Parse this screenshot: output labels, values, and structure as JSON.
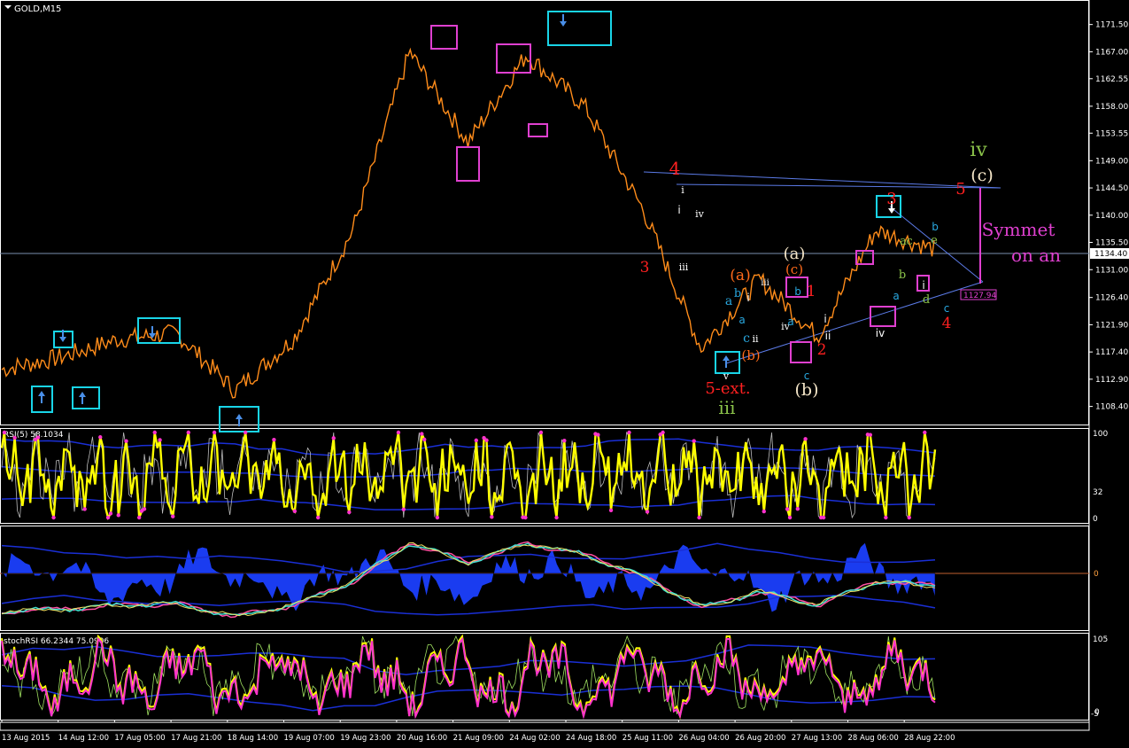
{
  "window": {
    "symbol_title": "GOLD,M15"
  },
  "price_axis": {
    "ticks": [
      "1171.50",
      "1167.00",
      "1162.55",
      "1158.00",
      "1153.55",
      "1149.00",
      "1144.50",
      "1140.00",
      "1135.50",
      "1131.00",
      "1126.40",
      "1121.90",
      "1117.40",
      "1112.90",
      "1108.40"
    ],
    "current_price": "1134.40",
    "target_box": "1127.94"
  },
  "time_axis": {
    "ticks": [
      "13 Aug 2015",
      "14 Aug 12:00",
      "17 Aug 05:00",
      "17 Aug 21:00",
      "18 Aug 14:00",
      "19 Aug 07:00",
      "19 Aug 23:00",
      "20 Aug 16:00",
      "21 Aug 09:00",
      "24 Aug 02:00",
      "24 Aug 18:00",
      "25 Aug 11:00",
      "26 Aug 04:00",
      "26 Aug 20:00",
      "27 Aug 13:00",
      "28 Aug 06:00",
      "28 Aug 22:00"
    ]
  },
  "wave_labels": [
    {
      "text": "4",
      "color": "#ff2020"
    },
    {
      "text": "3",
      "color": "#ff2020"
    },
    {
      "text": "i",
      "color": "#ffffff"
    },
    {
      "text": "ii",
      "color": "#ffffff"
    },
    {
      "text": "iii",
      "color": "#ffffff"
    },
    {
      "text": "iv",
      "color": "#ffffff"
    },
    {
      "text": "(a)",
      "color": "#ff6a1a"
    },
    {
      "text": "(b)",
      "color": "#ff6a1a"
    },
    {
      "text": "(c)",
      "color": "#ff6a1a"
    },
    {
      "text": "(a)",
      "color": "#f5e6c8"
    },
    {
      "text": "(b)",
      "color": "#f5e6c8"
    },
    {
      "text": "(c)",
      "color": "#f5e6c8"
    },
    {
      "text": "5-ext.",
      "color": "#ff2020"
    },
    {
      "text": "iii",
      "color": "#8bc34a"
    },
    {
      "text": "iv",
      "color": "#8bc34a"
    },
    {
      "text": "v",
      "color": "#ffffff"
    },
    {
      "text": "a",
      "color": "#29a8e0"
    },
    {
      "text": "b",
      "color": "#29a8e0"
    },
    {
      "text": "c",
      "color": "#29a8e0"
    },
    {
      "text": "1",
      "color": "#ff2020"
    },
    {
      "text": "2",
      "color": "#ff2020"
    },
    {
      "text": "3",
      "color": "#ff2020"
    },
    {
      "text": "4",
      "color": "#ff2020"
    },
    {
      "text": "5",
      "color": "#ff2020"
    },
    {
      "text": "iii",
      "color": "#ffffff"
    },
    {
      "text": "iv",
      "color": "#ffffff"
    },
    {
      "text": "a",
      "color": "#8bc34a"
    },
    {
      "text": "b",
      "color": "#8bc34a"
    },
    {
      "text": "c",
      "color": "#8bc34a"
    },
    {
      "text": "d",
      "color": "#8bc34a"
    },
    {
      "text": "e",
      "color": "#8bc34a"
    },
    {
      "text": "Symmet",
      "color": "#e040d0"
    },
    {
      "text": "on an",
      "color": "#e040d0"
    }
  ],
  "rsi_panel": {
    "title": "RSI(5) 58.1034",
    "levels": [
      "100",
      "32",
      "0"
    ]
  },
  "osc_panel": {
    "marker": "0"
  },
  "stochrsi_panel": {
    "title": "stochRSI 66.2344 75.0906",
    "levels": [
      "105",
      "0",
      "-5"
    ]
  },
  "colors": {
    "background": "#000000",
    "candles": "#ff8c1a",
    "axis": "#ffffff",
    "cyan_box": "#19d5e8",
    "magenta_box": "#e040d0",
    "trend": "#5b7ae6",
    "rsi_line": "#ffff00",
    "rsi_dots": "#ff33cc",
    "bands": "#1a2fd6"
  },
  "chart_data": {
    "type": "line",
    "title": "GOLD,M15",
    "xlabel": "",
    "ylabel": "",
    "x": [
      "13 Aug 2015",
      "14 Aug 12:00",
      "17 Aug 05:00",
      "17 Aug 21:00",
      "18 Aug 14:00",
      "19 Aug 07:00",
      "19 Aug 23:00",
      "20 Aug 16:00",
      "21 Aug 09:00",
      "24 Aug 02:00",
      "24 Aug 18:00",
      "25 Aug 11:00",
      "26 Aug 04:00",
      "26 Aug 20:00",
      "27 Aug 13:00",
      "28 Aug 06:00",
      "28 Aug 22:00"
    ],
    "series": [
      {
        "name": "",
        "values": [
          1114.5,
          1116.5,
          1119.5,
          1120.5,
          1111.0,
          1119.5,
          1137.0,
          1167.0,
          1152.0,
          1166.5,
          1158.0,
          1141.0,
          1118.0,
          1129.5,
          1120.0,
          1137.5,
          1134.4
        ]
      }
    ],
    "ylim": [
      1106.0,
      1173.5
    ],
    "grid": false,
    "current_price": 1134.4
  }
}
